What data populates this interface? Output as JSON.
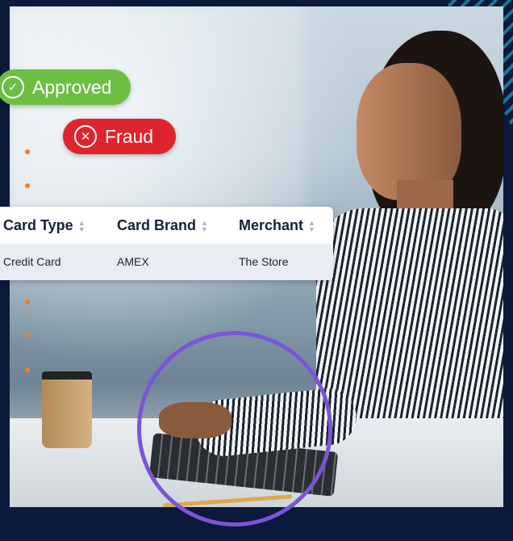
{
  "badges": {
    "approved": {
      "label": "Approved",
      "icon": "check-circle-icon",
      "color": "#6cbf43"
    },
    "fraud": {
      "label": "Fraud",
      "icon": "x-circle-icon",
      "color": "#e0242e"
    }
  },
  "table": {
    "columns": [
      "Card Type",
      "Card Brand",
      "Merchant"
    ],
    "rows": [
      [
        "Credit Card",
        "AMEX",
        "The Store"
      ]
    ]
  },
  "colors": {
    "background": "#0b1a3a",
    "accent_dot": "#ff7a1a",
    "ring": "#7b55d6"
  }
}
